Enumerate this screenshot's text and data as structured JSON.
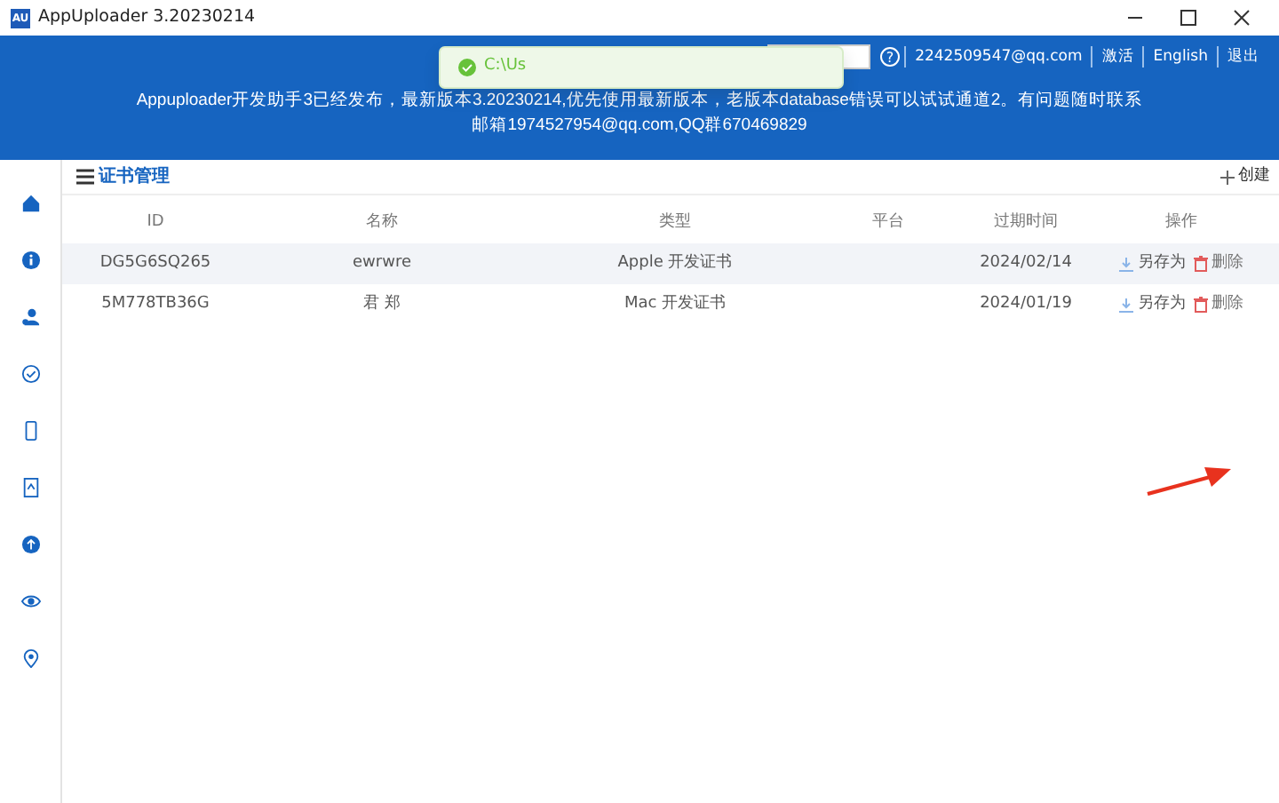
{
  "window": {
    "title": "AppUploader 3.20230214",
    "logo": "AU"
  },
  "header": {
    "account": "2242509547@qq.com",
    "links": [
      "激活",
      "English",
      "退出"
    ],
    "help": "?",
    "notice": [
      "Appuploader开发助手3已经发布，最新版本3.20230214,优先使用最新版本，老版本database错误可以试试通道2。有问题随时联系",
      "邮箱1974527954@qq.com,QQ群670469829"
    ]
  },
  "toast": {
    "text": "C:\\Us"
  },
  "page": {
    "title": "证书管理",
    "create": "创建"
  },
  "table": {
    "columns": [
      "ID",
      "名称",
      "类型",
      "平台",
      "过期时间",
      "操作"
    ],
    "rows": [
      {
        "id": "DG5G6SQ265",
        "name": "ewrwre",
        "type": "Apple 开发证书",
        "expires": "2024/02/14",
        "save": "另存为",
        "delete": "删除",
        "selected": true
      },
      {
        "id": "5M778TB36G",
        "name": "君 郑",
        "type": "Mac 开发证书",
        "expires": "2024/01/19",
        "save": "另存为",
        "delete": "删除",
        "selected": false
      }
    ]
  }
}
